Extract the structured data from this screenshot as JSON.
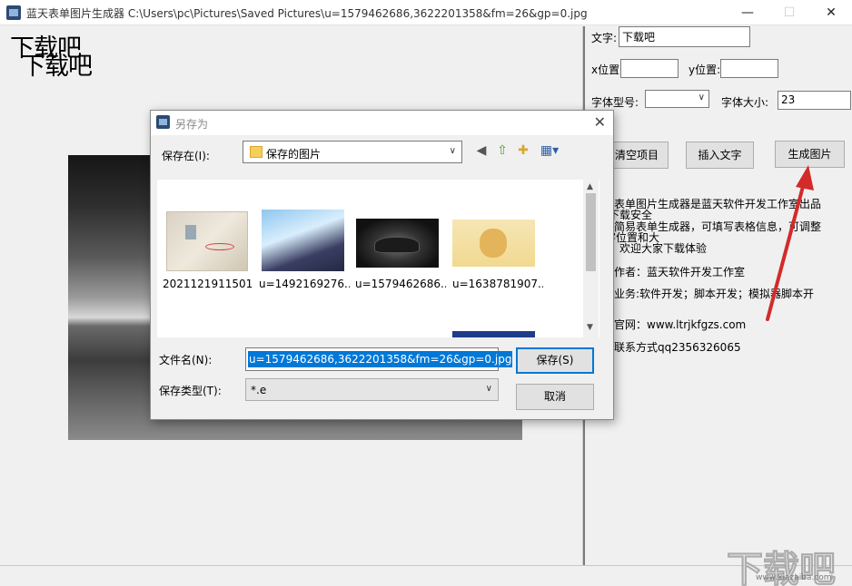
{
  "window": {
    "title": "蓝天表单图片生成器  C:\\Users\\pc\\Pictures\\Saved Pictures\\u=1579462686,3622201358&fm=26&gp=0.jpg",
    "minimize": "—",
    "maximize": "☐",
    "close": "✕"
  },
  "canvas": {
    "overlay_text_1": "下载吧",
    "overlay_text_2": "下载吧"
  },
  "panel": {
    "text_label": "文字:",
    "text_value": "下载吧",
    "x_label": "x位置",
    "x_value": "",
    "y_label": "y位置:",
    "y_value": "",
    "font_type_label": "字体型号:",
    "font_type_value": "",
    "font_size_label": "字体大小:",
    "font_size_value": "23",
    "clear_button": "清空项目",
    "insert_button": "插入文字",
    "generate_button": "生成图片",
    "info_lines": [
      "天表单图片生成器是蓝天软件开发工作室出品",
      "下载安全",
      "款简易表单生成器，可填写表格信息，可调整",
      "字位置和大",
      "欢迎大家下载体验",
      "件作者：蓝天软件开发工作室",
      "门业务:软件开发；脚本开发；模拟器脚本开",
      "门官网：www.ltrjkfgzs.com",
      "门联系方式qq2356326065"
    ]
  },
  "dialog": {
    "title": "另存为",
    "close": "✕",
    "save_in_label": "保存在(I):",
    "save_in_value": "保存的图片",
    "back_icon": "◀",
    "up_icon": "⇧",
    "newfolder_icon": "✚",
    "view_icon": "▦▾",
    "files": [
      {
        "name": "2021121911501..."
      },
      {
        "name": "u=1492169276..."
      },
      {
        "name": "u=1579462686..."
      },
      {
        "name": "u=1638781907..."
      }
    ],
    "filename_label": "文件名(N):",
    "filename_value": "u=1579462686,3622201358&fm=26&gp=0.jpg",
    "filetype_label": "保存类型(T):",
    "filetype_value": "*.e",
    "save_button": "保存(S)",
    "cancel_button": "取消"
  },
  "watermark": {
    "logo_text": "下载吧",
    "url": "www.xiazaiba.com"
  },
  "colors": {
    "accent": "#0078d7",
    "arrow": "#d42a2a"
  }
}
